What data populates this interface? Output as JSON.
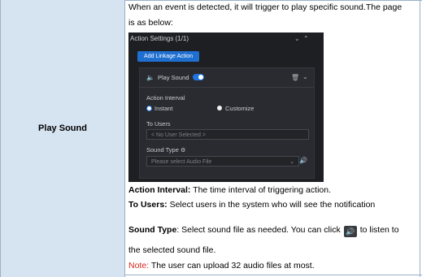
{
  "row_label": "Play Sound",
  "intro": {
    "line1": "When an event is detected, it will trigger to play specific sound.The page",
    "line2": "is as below:"
  },
  "screenshot": {
    "title": "Action Settings (1/1)",
    "add_button": "Add Linkage Action",
    "card_title": "Play Sound",
    "toggle_on": true,
    "action_interval_label": "Action Interval",
    "option_instant": "Instant",
    "option_customize": "Customize",
    "to_users_label": "To Users",
    "to_users_value": "< No User Selected >",
    "sound_type_label": "Sound Type",
    "sound_placeholder": "Please select Audio File"
  },
  "descriptions": {
    "action_interval_term": "Action Interval:",
    "action_interval_text": " The time interval of triggering action.",
    "to_users_term": "To Users:",
    "to_users_text": " Select users in the system who will see the notification",
    "sound_type_term": "Sound Type",
    "sound_type_text": ": Select sound file as needed. You can click",
    "sound_type_text2": "to listen to",
    "sound_type_line2": "the selected sound file.",
    "note_label": "Note:",
    "note_text": " The user can upload 32 audio files at most."
  },
  "colors": {
    "label_cell_bg": "#d6e4f2",
    "panel_bg": "#1e1f22",
    "accent_blue": "#1f6fd0",
    "note_red": "#d4281f"
  }
}
